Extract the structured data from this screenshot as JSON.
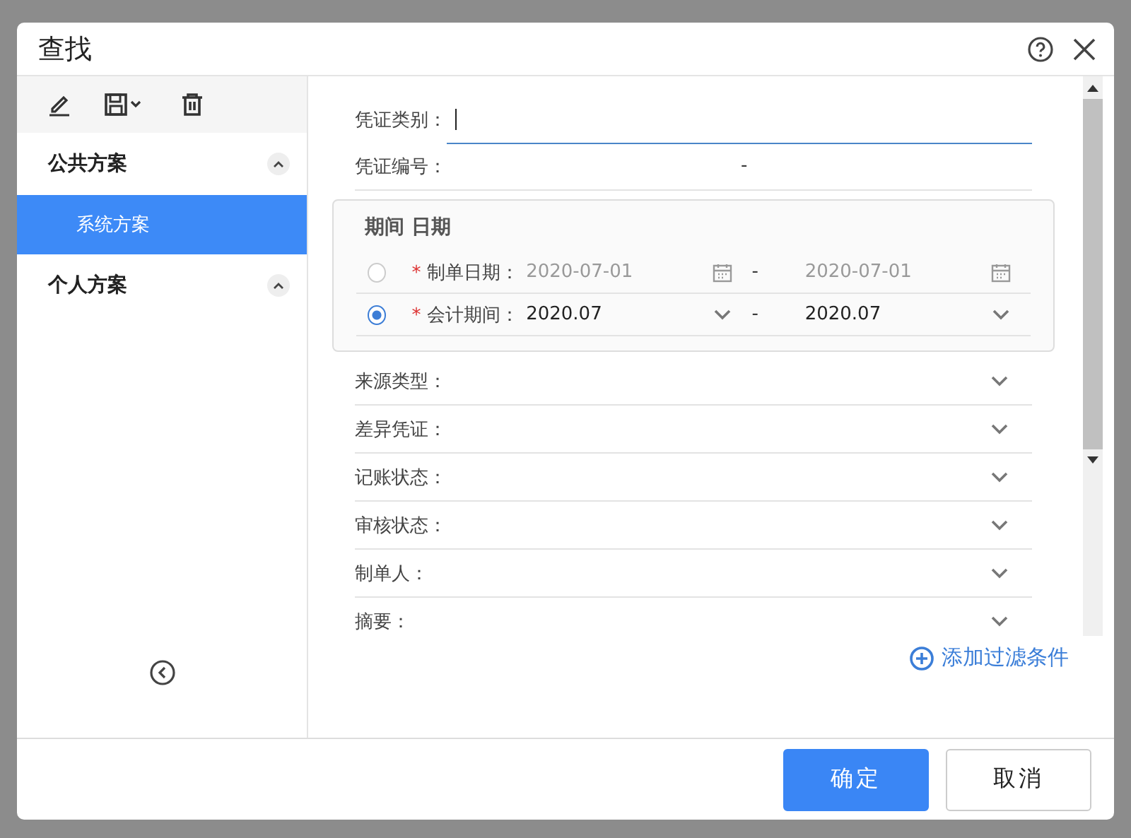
{
  "window": {
    "title": "查找"
  },
  "sidebar": {
    "groups": [
      {
        "label": "公共方案",
        "expanded": true,
        "items": [
          {
            "label": "系统方案",
            "selected": true
          }
        ]
      },
      {
        "label": "个人方案",
        "expanded": true
      }
    ]
  },
  "fields": [
    {
      "kind": "text",
      "label": "凭证类别：",
      "focused": true
    },
    {
      "kind": "range",
      "label": "凭证编号：",
      "separator": "-"
    }
  ],
  "period_group": {
    "title": "期间 日期",
    "rows": [
      {
        "kind": "date",
        "selected": false,
        "required_mark": "*",
        "label": "制单日期：",
        "from": "2020-07-01",
        "separator": "-",
        "to": "2020-07-01"
      },
      {
        "kind": "period",
        "selected": true,
        "required_mark": "*",
        "label": "会计期间：",
        "from": "2020.07",
        "separator": "-",
        "to": "2020.07"
      }
    ]
  },
  "filters": [
    {
      "kind": "select",
      "label": "来源类型："
    },
    {
      "kind": "select",
      "label": "差异凭证："
    },
    {
      "kind": "select",
      "label": "记账状态："
    },
    {
      "kind": "select",
      "label": "审核状态："
    },
    {
      "kind": "select",
      "label": "制单人："
    },
    {
      "kind": "select",
      "label": "摘要："
    }
  ],
  "add_filter": "添加过滤条件",
  "buttons": [
    {
      "label": "确定",
      "primary": true
    },
    {
      "label": "取消",
      "primary": false
    }
  ]
}
